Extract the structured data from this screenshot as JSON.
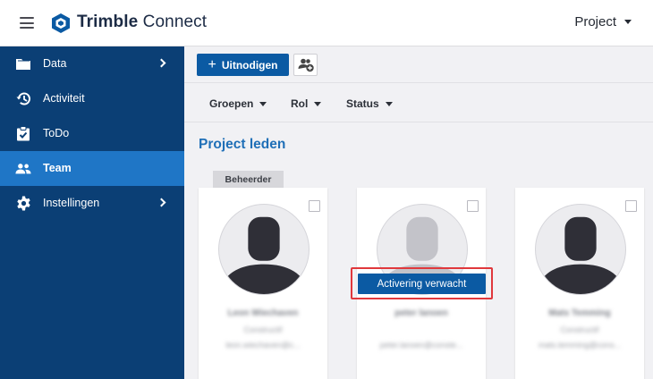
{
  "app": {
    "brand_bold": "Trimble",
    "brand_light": "Connect",
    "project_label": "Project"
  },
  "sidebar": {
    "items": [
      {
        "label": "Data",
        "icon": "folder-icon",
        "has_submenu": true,
        "active": false
      },
      {
        "label": "Activiteit",
        "icon": "history-icon",
        "has_submenu": false,
        "active": false
      },
      {
        "label": "ToDo",
        "icon": "clipboard-check-icon",
        "has_submenu": false,
        "active": false
      },
      {
        "label": "Team",
        "icon": "people-icon",
        "has_submenu": false,
        "active": true
      },
      {
        "label": "Instellingen",
        "icon": "gear-icon",
        "has_submenu": true,
        "active": false
      }
    ]
  },
  "toolbar": {
    "invite_label": "Uitnodigen",
    "group_icon": "add-group-icon"
  },
  "filters": {
    "groups": "Groepen",
    "role": "Rol",
    "status": "Status"
  },
  "main": {
    "section_title": "Project leden",
    "admin_badge": "Beheerder",
    "pending_label": "Activering verwacht"
  },
  "members": [
    {
      "name": "Leon Wiechaven",
      "company": "Constructif",
      "email": "leon.wiechaven@c..."
    },
    {
      "name": "peter lanoen",
      "company": "",
      "email": "peter.lanoen@conste..."
    },
    {
      "name": "Mats Temming",
      "company": "Constructif",
      "email": "mats.temming@cons..."
    }
  ],
  "colors": {
    "sidebar_bg": "#0b3f75",
    "sidebar_active": "#1f76c6",
    "primary": "#0b5aa3",
    "title": "#1f6fb7",
    "highlight": "#e0383c"
  }
}
